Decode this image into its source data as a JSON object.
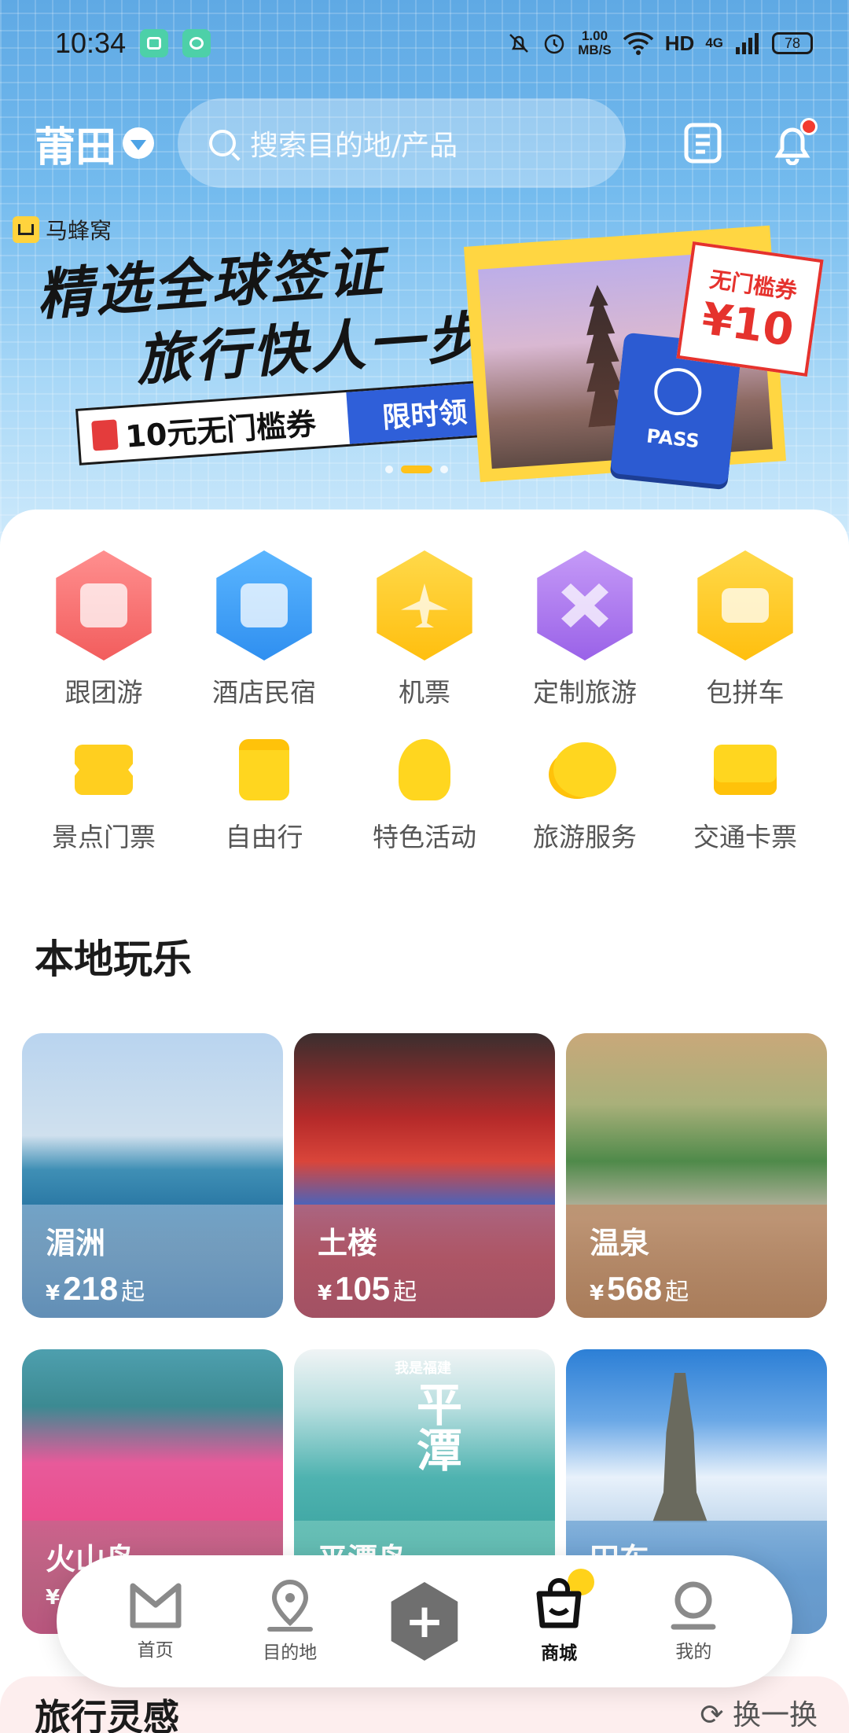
{
  "status_bar": {
    "time": "10:34",
    "speed_value": "1.00",
    "speed_unit": "MB/S",
    "hd": "HD",
    "network": "4G",
    "battery": "78"
  },
  "header": {
    "city": "莆田",
    "search_placeholder": "搜索目的地/产品"
  },
  "banner": {
    "brand": "马蜂窝",
    "title_line1": "精选全球签证",
    "title_line2": "旅行快人一步!",
    "coupon_text": "10元无门槛券",
    "coupon_button": "限时领",
    "ticket_line1": "无门槛券",
    "ticket_line2": "¥10",
    "passport_label": "PASS"
  },
  "categories_primary": [
    {
      "label": "跟团游",
      "color": "#ff7b7b"
    },
    {
      "label": "酒店民宿",
      "color": "#4aa8f4"
    },
    {
      "label": "机票",
      "color": "#ffcc26"
    },
    {
      "label": "定制旅游",
      "color": "#b07cf0"
    },
    {
      "label": "包拼车",
      "color": "#ffcc26"
    }
  ],
  "categories_secondary": [
    {
      "label": "景点门票"
    },
    {
      "label": "自由行"
    },
    {
      "label": "特色活动"
    },
    {
      "label": "旅游服务"
    },
    {
      "label": "交通卡票"
    }
  ],
  "local_section": {
    "title": "本地玩乐",
    "cards": [
      {
        "name": "湄洲",
        "currency": "¥",
        "price": "218",
        "suffix": "起"
      },
      {
        "name": "土楼",
        "currency": "¥",
        "price": "105",
        "suffix": "起"
      },
      {
        "name": "温泉",
        "currency": "¥",
        "price": "568",
        "suffix": "起"
      },
      {
        "name": "火山岛",
        "currency": "¥",
        "price": "",
        "suffix": ""
      },
      {
        "name": "平潭岛",
        "currency": "",
        "price": "",
        "suffix": ""
      },
      {
        "name": "田东",
        "currency": "",
        "price": "",
        "suffix": ""
      }
    ],
    "pingtan_overlay": "平潭",
    "pingtan_sub": "我是福建"
  },
  "inspire": {
    "title": "旅行灵感",
    "refresh": "换一换"
  },
  "tabbar": {
    "home": "首页",
    "destination": "目的地",
    "plus": "+",
    "mall": "商城",
    "me": "我的"
  }
}
